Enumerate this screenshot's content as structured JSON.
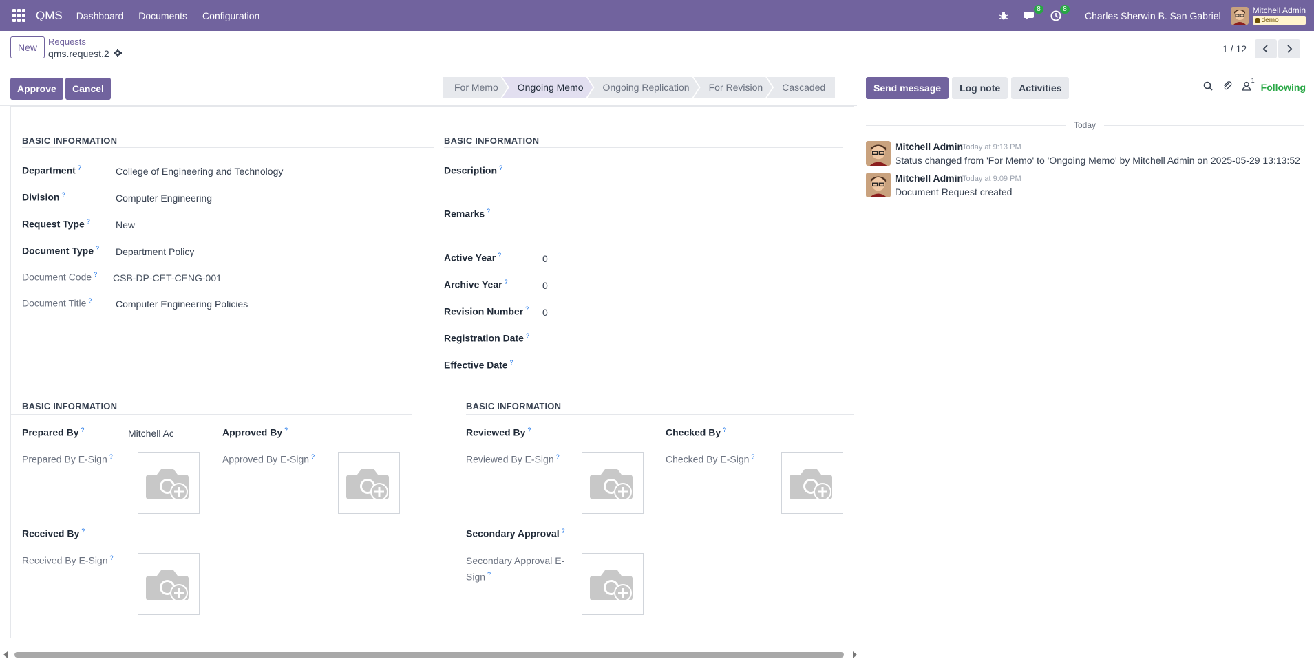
{
  "navbar": {
    "brand": "QMS",
    "menus": [
      "Dashboard",
      "Documents",
      "Configuration"
    ],
    "messages_count": "8",
    "activities_count": "8",
    "company": "Charles Sherwin B. San Gabriel",
    "user_name": "Mitchell Admin",
    "database": "demo",
    "bg_color": "#71639e"
  },
  "control_panel": {
    "new_label": "New",
    "breadcrumb": "Requests",
    "record_name": "qms.request.2",
    "pager_value": "1 / 12"
  },
  "actions": {
    "approve_label": "Approve",
    "cancel_label": "Cancel"
  },
  "statusbar": {
    "stages": [
      "For Memo",
      "Ongoing Memo",
      "Ongoing Replication",
      "For Revision",
      "Cascaded"
    ],
    "active": "Ongoing Memo"
  },
  "form": {
    "group1": {
      "title": "BASIC INFORMATION",
      "fields": [
        {
          "label": "Department",
          "value": "College of Engineering and Technology"
        },
        {
          "label": "Division",
          "value": "Computer Engineering"
        },
        {
          "label": "Request Type",
          "value": "New"
        },
        {
          "label": "Document Type",
          "value": "Department Policy"
        },
        {
          "label": "Document Code",
          "value": "CSB-DP-CET-CENG-001"
        },
        {
          "label": "Document Title",
          "value": "Computer Engineering Policies"
        }
      ]
    },
    "group2": {
      "title": "BASIC INFORMATION",
      "fields": [
        {
          "label": "Description",
          "value": ""
        },
        {
          "label": "Remarks",
          "value": ""
        },
        {
          "label": "Active Year",
          "value": "0"
        },
        {
          "label": "Archive Year",
          "value": "0"
        },
        {
          "label": "Revision Number",
          "value": "0"
        },
        {
          "label": "Registration Date",
          "value": ""
        },
        {
          "label": "Effective Date",
          "value": ""
        }
      ]
    },
    "group3": {
      "title": "BASIC INFORMATION",
      "prepared_by": "Prepared By",
      "prepared_by_value": "Mitchell Ac",
      "prepared_esign": "Prepared By E-Sign",
      "approved_by": "Approved By",
      "approved_esign": "Approved By E-Sign",
      "received_by": "Received By",
      "received_esign": "Received By E-Sign"
    },
    "group4": {
      "title": "BASIC INFORMATION",
      "reviewed_by": "Reviewed By",
      "reviewed_esign": "Reviewed By E-Sign",
      "checked_by": "Checked By",
      "checked_esign": "Checked By E-Sign",
      "secondary_approval": "Secondary Approval",
      "secondary_esign_line1": "Secondary Approval E-",
      "secondary_esign_line2": "Sign"
    },
    "help_mark": "?"
  },
  "chatter": {
    "send_message": "Send message",
    "log_note": "Log note",
    "activities": "Activities",
    "followers_count": "1",
    "following": "Following",
    "date_separator": "Today",
    "messages": [
      {
        "author": "Mitchell Admin",
        "time": "Today at 9:13 PM",
        "body": "Status changed from 'For Memo' to 'Ongoing Memo' by Mitchell Admin on 2025-05-29 13:13:52"
      },
      {
        "author": "Mitchell Admin",
        "time": "Today at 9:09 PM",
        "body": "Document Request created"
      }
    ]
  }
}
